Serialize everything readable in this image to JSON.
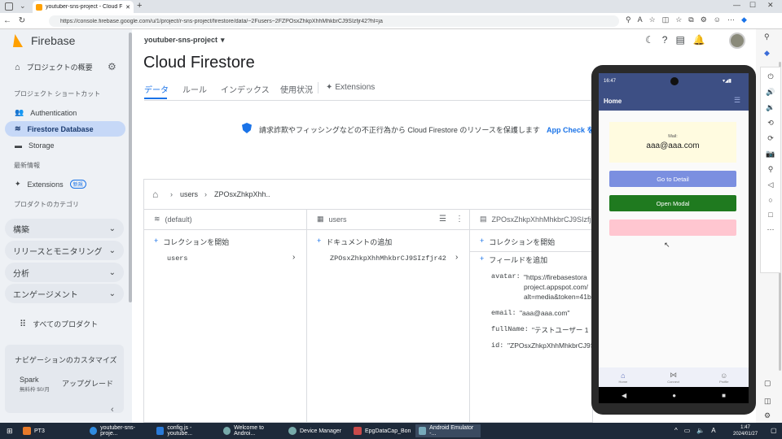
{
  "browser": {
    "tab_title": "youtuber-sns-project - Cloud Fir...",
    "url": "https://console.firebase.google.com/u/1/project/r-sns-project/firestore/data/~2Fusers~2FZPOsxZhkpXhhMhkbrCJ9SIzfjr42?hl=ja"
  },
  "sidebar": {
    "brand": "Firebase",
    "overview": "プロジェクトの概要",
    "shortcuts_head": "プロジェクト ショートカット",
    "items": [
      {
        "label": "Authentication"
      },
      {
        "label": "Firestore Database"
      },
      {
        "label": "Storage"
      }
    ],
    "recent_head": "最新情報",
    "extensions": "Extensions",
    "extensions_badge": "新規",
    "categories_head": "プロダクトのカテゴリ",
    "sections": [
      {
        "label": "構築"
      },
      {
        "label": "リリースとモニタリング"
      },
      {
        "label": "分析"
      },
      {
        "label": "エンゲージメント"
      }
    ],
    "all_products": "すべてのプロダクト",
    "customize": "ナビゲーションのカスタマイズ",
    "plan": "Spark",
    "plan_price": "無料枠 $0/月",
    "upgrade": "アップグレード"
  },
  "header": {
    "project": "youtuber-sns-project",
    "title": "Cloud Firestore",
    "tabs": [
      "データ",
      "ルール",
      "インデックス",
      "使用状況",
      "Extensions"
    ]
  },
  "banner": {
    "text": "請求詐欺やフィッシングなどの不正行為から Cloud Firestore のリソースを保護します",
    "link": "App Check を"
  },
  "breadcrumb": {
    "collection": "users",
    "document": "ZPOsxZhkpXhh.."
  },
  "columns": {
    "root": {
      "title": "(default)",
      "add": "コレクションを開始",
      "items": [
        "users"
      ]
    },
    "collection": {
      "title": "users",
      "add": "ドキュメントの追加",
      "items": [
        "ZPOsxZhkpXhhMhkbrCJ9SIzfjr42"
      ]
    },
    "document": {
      "title": "ZPOsxZhkpXhhMhkbrCJ9SIzfjr",
      "add_collection": "コレクションを開始",
      "add_field": "フィールドを追加",
      "fields": [
        {
          "key": "avatar:",
          "value_lines": [
            "\"https://firebasestora",
            "project.appspot.com/",
            "alt=media&token=41b"
          ]
        },
        {
          "key": "email:",
          "value": "\"aaa@aaa.com\""
        },
        {
          "key": "fullName:",
          "value": "\"テストユーザー 1"
        },
        {
          "key": "id:",
          "value": "\"ZPOsxZhkpXhhMhkbrCJ9S"
        }
      ]
    }
  },
  "phone": {
    "time": "16:47",
    "app_title": "Home",
    "mail_label": "Mail:",
    "mail_value": "aaa@aaa.com",
    "btn_detail": "Go to Detail",
    "btn_modal": "Open Modal",
    "btn_third": "",
    "nav": [
      "Home",
      "Connect",
      "Profile"
    ]
  },
  "taskbar": {
    "items": [
      {
        "label": "PT3"
      },
      {
        "label": "youtuber-sns-proje..."
      },
      {
        "label": "config.js - youtube..."
      },
      {
        "label": "Welcome to Androi..."
      },
      {
        "label": "Device Manager"
      },
      {
        "label": "EpgDataCap_Bon"
      },
      {
        "label": "Android Emulator -..."
      }
    ],
    "time": "1:47",
    "date": "2024/01/27",
    "ime": "A"
  },
  "colors": {
    "brand": "#ffa000",
    "active_item": "#c6d8f7",
    "tab_active": "#1a73e8",
    "app_bar": "#3d4f84",
    "btn_detail": "#7b8fe0",
    "btn_modal": "#1f7a1f",
    "btn_third": "#ffc6d0"
  }
}
